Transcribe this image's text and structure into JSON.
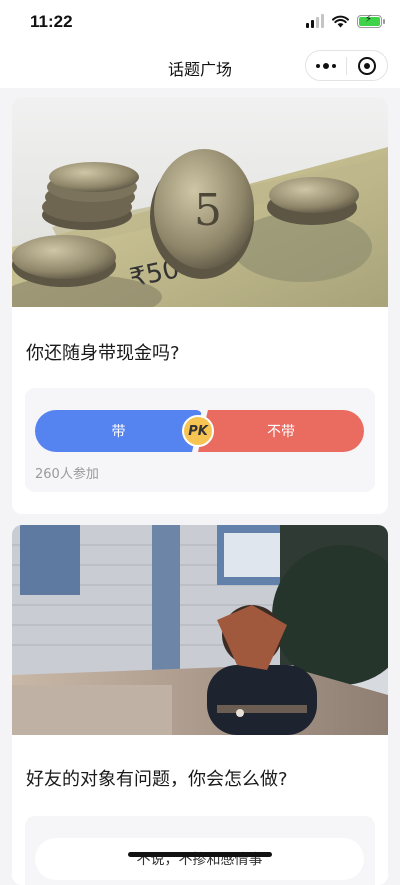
{
  "status_bar": {
    "time": "11:22"
  },
  "nav": {
    "title": "话题广场"
  },
  "topics": [
    {
      "question": "你还随身带现金吗?",
      "option_a": "带",
      "option_b": "不带",
      "pk_label": "PK",
      "participants": "260人参加"
    },
    {
      "question": "好友的对象有问题，你会怎么做?",
      "option_a": "不说，不掺和感情事"
    }
  ],
  "colors": {
    "option_a": "#5584f0",
    "option_b": "#ea6b60",
    "pk_badge": "#f6c453",
    "battery": "#3fd34a"
  },
  "icons": [
    "signal-icon",
    "wifi-icon",
    "battery-icon",
    "more-icon",
    "target-icon"
  ]
}
